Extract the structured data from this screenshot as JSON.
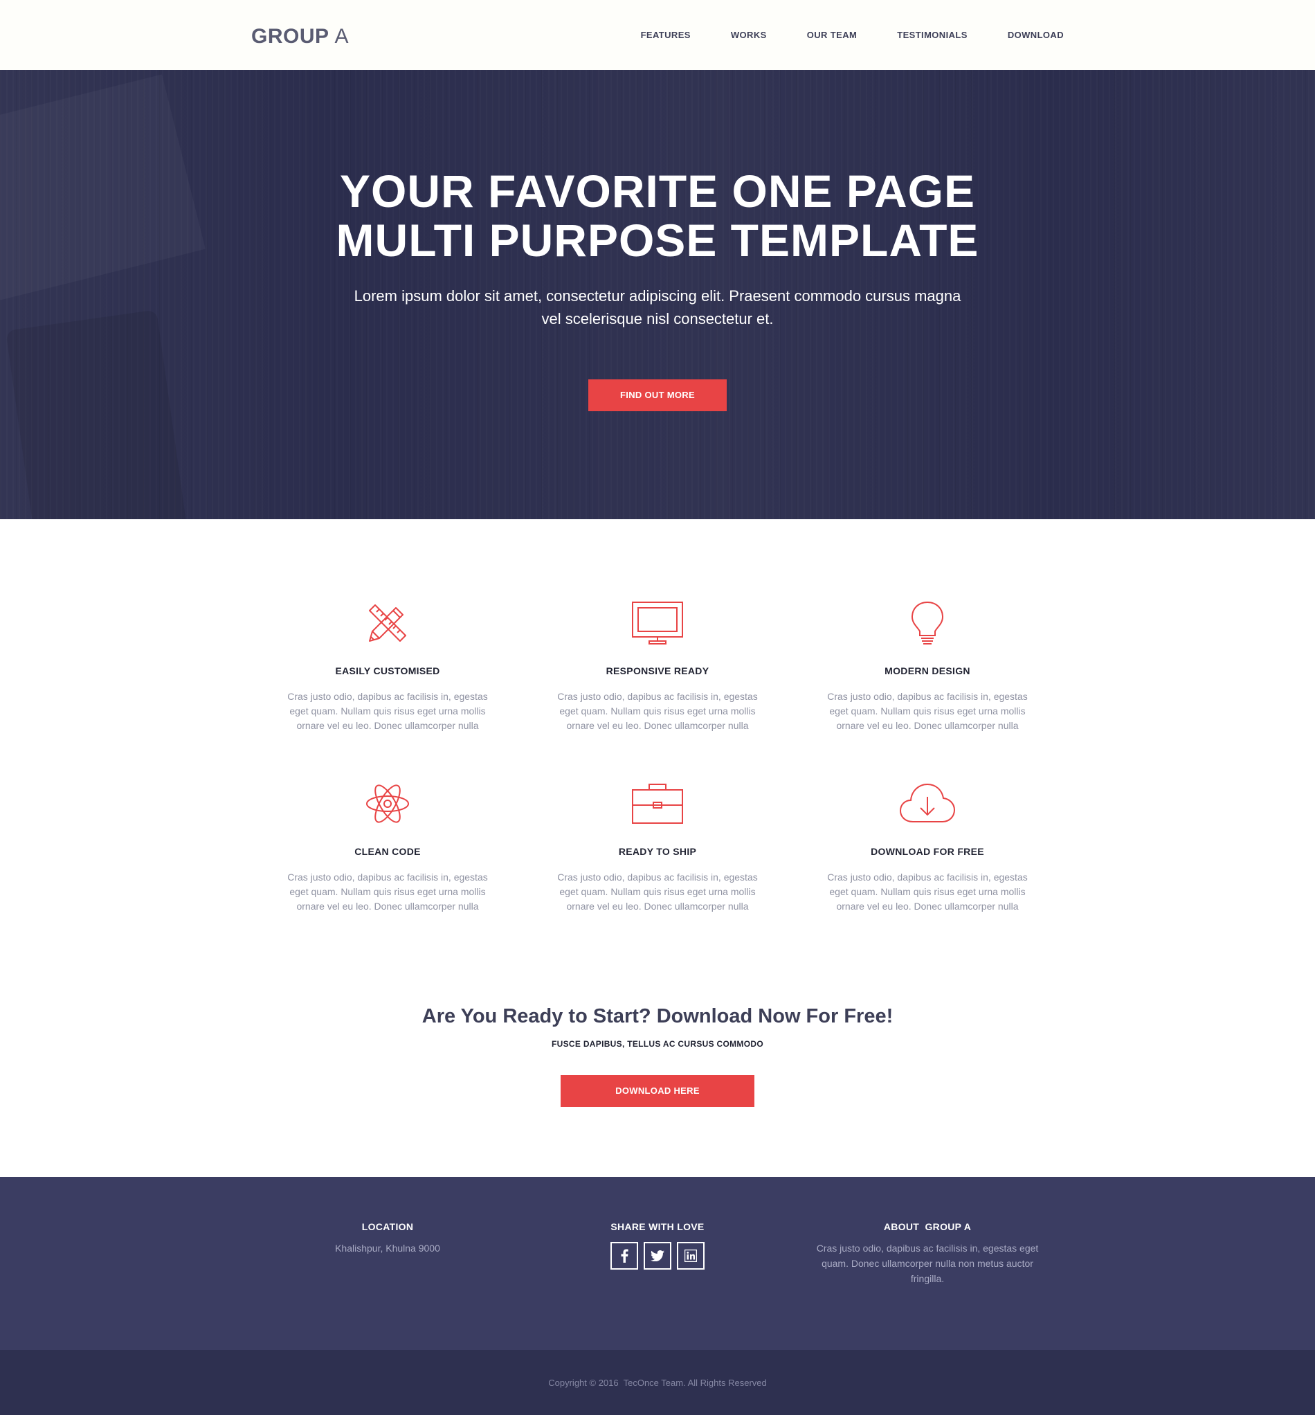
{
  "nav": {
    "logo_bold": "GROUP",
    "logo_thin": "A",
    "links": [
      "FEATURES",
      "WORKS",
      "OUR TEAM",
      "TESTIMONIALS",
      "DOWNLOAD"
    ]
  },
  "hero": {
    "title_line1": "YOUR FAVORITE ONE PAGE",
    "title_line2": "MULTI PURPOSE TEMPLATE",
    "subtitle_line1": "Lorem ipsum dolor sit amet, consectetur adipiscing elit. Praesent commodo cursus magna",
    "subtitle_line2": "vel scelerisque nisl consectetur et.",
    "button": "FIND OUT MORE"
  },
  "features": [
    {
      "icon": "pencil-ruler-icon",
      "title": "EASILY CUSTOMISED",
      "text_lines": [
        "Cras justo odio, dapibus ac facilisis in, egestas",
        "eget quam. Nullam quis risus eget urna mollis",
        "ornare vel eu leo. Donec ullamcorper nulla"
      ]
    },
    {
      "icon": "monitor-icon",
      "title": "RESPONSIVE READY",
      "text_lines": [
        "Cras justo odio, dapibus ac facilisis in, egestas",
        "eget quam. Nullam quis risus eget urna mollis",
        "ornare vel eu leo. Donec ullamcorper nulla"
      ]
    },
    {
      "icon": "lightbulb-icon",
      "title": "MODERN DESIGN",
      "text_lines": [
        "Cras justo odio, dapibus ac facilisis in, egestas",
        "eget quam. Nullam quis risus eget urna mollis",
        "ornare vel eu leo. Donec ullamcorper nulla"
      ]
    },
    {
      "icon": "atom-icon",
      "title": "CLEAN CODE",
      "text_lines": [
        "Cras justo odio, dapibus ac facilisis in, egestas",
        "eget quam. Nullam quis risus eget urna mollis",
        "ornare vel eu leo. Donec ullamcorper nulla"
      ]
    },
    {
      "icon": "briefcase-icon",
      "title": "READY TO SHIP",
      "text_lines": [
        "Cras justo odio, dapibus ac facilisis in, egestas",
        "eget quam. Nullam quis risus eget urna mollis",
        "ornare vel eu leo. Donec ullamcorper nulla"
      ]
    },
    {
      "icon": "cloud-download-icon",
      "title": "DOWNLOAD FOR FREE",
      "text_lines": [
        "Cras justo odio, dapibus ac facilisis in, egestas",
        "eget quam. Nullam quis risus eget urna mollis",
        "ornare vel eu leo. Donec ullamcorper nulla"
      ]
    }
  ],
  "cta": {
    "title": "Are You Ready to Start? Download Now For Free!",
    "subtitle": "FUSCE DAPIBUS, TELLUS AC CURSUS COMMODO",
    "button": "DOWNLOAD HERE"
  },
  "footer": {
    "location_title": "LOCATION",
    "location_text": "Khalishpur, Khulna 9000",
    "share_title": "SHARE WITH LOVE",
    "social_icons": [
      "facebook-icon",
      "twitter-icon",
      "linkedin-icon"
    ],
    "about_title": "ABOUT  GROUP A",
    "about_lines": [
      "Cras justo odio, dapibus ac facilisis in, egestas eget",
      "quam. Donec ullamcorper nulla non metus auctor",
      "fringilla."
    ],
    "copyright": "Copyright © 2016  TecOnce Team. All Rights Reserved"
  },
  "colors": {
    "accent": "#e84445",
    "hero_bg": "#2b2d4d",
    "footer_bg": "#3b3d62",
    "copyright_bg": "#2e3050",
    "nav_bg": "#fefefa"
  }
}
